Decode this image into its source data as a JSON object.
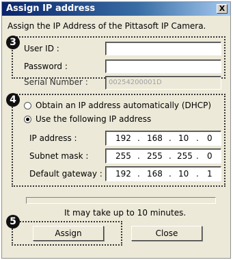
{
  "window": {
    "title": "Assign IP address",
    "close_glyph": "X"
  },
  "intro_text": "Assign the IP Address of the Pittasoft IP Camera.",
  "markers": {
    "credentials": "3",
    "network": "4",
    "actions": "5"
  },
  "credentials": {
    "user_id_label": "User ID :",
    "user_id_value": "",
    "password_label": "Password :",
    "password_value": ""
  },
  "serial": {
    "label": "Serial Number :",
    "value": "00254200001D"
  },
  "network": {
    "dhcp_label": "Obtain an IP address automatically (DHCP)",
    "dhcp_selected": false,
    "static_label": "Use the following IP address",
    "static_selected": true,
    "ip_label": "IP address :",
    "ip": [
      "192",
      "168",
      "10",
      "0"
    ],
    "mask_label": "Subnet mask :",
    "mask": [
      "255",
      "255",
      "255",
      "0"
    ],
    "gateway_label": "Default gateway :",
    "gateway": [
      "192",
      "168",
      "10",
      "1"
    ],
    "octet_separator": "."
  },
  "progress": {
    "value_fraction": 0
  },
  "notice": "It may take up to 10 minutes.",
  "buttons": {
    "assign": "Assign",
    "close": "Close"
  }
}
